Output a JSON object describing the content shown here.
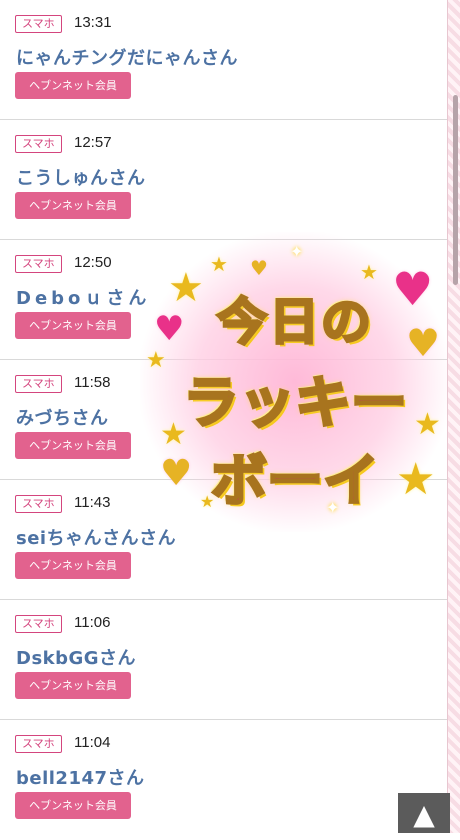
{
  "entries": [
    {
      "device": "スマホ",
      "time": "13:31",
      "name": "にゃんチングだにゃんさん",
      "member": "ヘブンネット会員"
    },
    {
      "device": "スマホ",
      "time": "12:57",
      "name": "こうしゅんさん",
      "member": "ヘブンネット会員"
    },
    {
      "device": "スマホ",
      "time": "12:50",
      "name": "Deboｕさん",
      "member": "ヘブンネット会員"
    },
    {
      "device": "スマホ",
      "time": "11:58",
      "name": "みづちさん",
      "member": "ヘブンネット会員"
    },
    {
      "device": "スマホ",
      "time": "11:43",
      "name": "seiちゃんさんさん",
      "member": "ヘブンネット会員"
    },
    {
      "device": "スマホ",
      "time": "11:06",
      "name": "DskbGGさん",
      "member": "ヘブンネット会員"
    },
    {
      "device": "スマホ",
      "time": "11:04",
      "name": "bell2147さん",
      "member": "ヘブンネット会員"
    }
  ],
  "banner": {
    "line1": "今日の",
    "line2": "ラッキー",
    "line3": "ボーイ"
  },
  "to_top": {
    "icon": "triangle-up-icon",
    "glyph": "▲"
  },
  "colors": {
    "accent": "#e2628e",
    "name_blue": "#4d72a3",
    "badge_pink": "#d4457e"
  }
}
